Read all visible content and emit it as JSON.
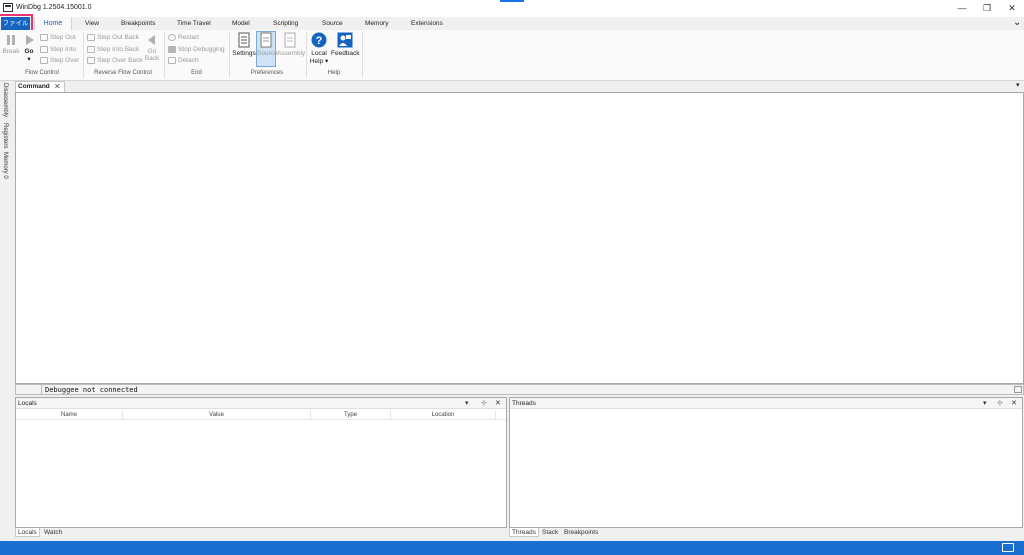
{
  "window": {
    "title": "WinDbg 1.2504.15001.0",
    "minimize": "—",
    "restore": "❐",
    "close": "✕"
  },
  "tabs": {
    "file": "ファイル",
    "home": "Home",
    "view": "View",
    "breakpoints": "Breakpoints",
    "time_travel": "Time Travel",
    "model": "Model",
    "scripting": "Scripting",
    "source": "Source",
    "memory": "Memory",
    "extensions": "Extensions",
    "collapse": "⌄"
  },
  "ribbon": {
    "flow_control": {
      "label": "Flow Control",
      "break": "Break",
      "go": "Go",
      "go_arrow": "▾",
      "step_out": "Step Out",
      "step_into": "Step Into",
      "step_over": "Step Over"
    },
    "reverse_flow": {
      "label": "Reverse Flow Control",
      "step_out_back": "Step Out Back",
      "step_into_back": "Step Into Back",
      "step_over_back": "Step Over Back",
      "go_back_1": "Go",
      "go_back_2": "Back"
    },
    "end": {
      "label": "End",
      "restart": "Restart",
      "stop_debugging": "Stop Debugging",
      "detach": "Detach"
    },
    "preferences": {
      "label": "Preferences",
      "settings": "Settings",
      "source": "Source",
      "assembly": "Assembly"
    },
    "help": {
      "label": "Help",
      "local_help_1": "Local",
      "local_help_2": "Help ▾",
      "feedback": "Feedback"
    }
  },
  "side_tabs": [
    "Disassembly",
    "Registers",
    "Memory 0"
  ],
  "command": {
    "tab": "Command",
    "close": "✕",
    "menu": "▾",
    "status": "Debuggee not connected"
  },
  "locals": {
    "title": "Locals",
    "columns": [
      "Name",
      "Value",
      "Type",
      "Location"
    ],
    "tabs": [
      "Locals",
      "Watch"
    ]
  },
  "threads": {
    "title": "Threads",
    "tabs": [
      "Threads",
      "Stack",
      "Breakpoints"
    ]
  },
  "panel_controls": {
    "menu": "▾",
    "pin": "⊹",
    "close": "✕"
  },
  "colors": {
    "accent": "#1565c0",
    "highlight": "#e8336b",
    "statusbar": "#1a6fd1"
  }
}
